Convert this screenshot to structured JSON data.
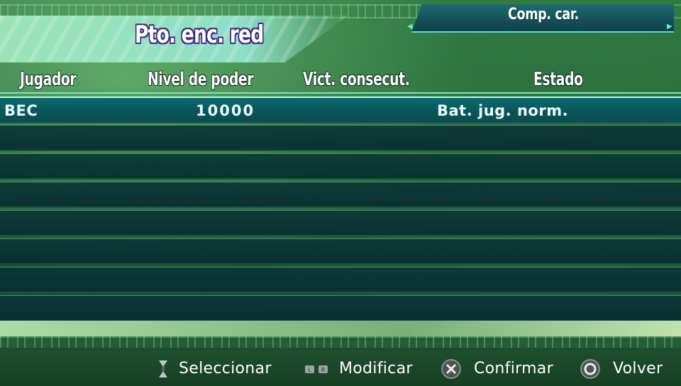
{
  "header": {
    "title": "Pto. enc. red",
    "mode_tab": "Comp. car."
  },
  "table": {
    "columns": [
      "Jugador",
      "Nivel de poder",
      "Vict. consecut.",
      "Estado"
    ],
    "rows": [
      {
        "player": "BEC",
        "power": "10000",
        "wins": "",
        "status": "Bat. jug. norm."
      },
      {
        "player": "",
        "power": "",
        "wins": "",
        "status": ""
      },
      {
        "player": "",
        "power": "",
        "wins": "",
        "status": ""
      },
      {
        "player": "",
        "power": "",
        "wins": "",
        "status": ""
      },
      {
        "player": "",
        "power": "",
        "wins": "",
        "status": ""
      },
      {
        "player": "",
        "power": "",
        "wins": "",
        "status": ""
      },
      {
        "player": "",
        "power": "",
        "wins": "",
        "status": ""
      },
      {
        "player": "",
        "power": "",
        "wins": "",
        "status": ""
      }
    ],
    "selected_row": 0
  },
  "footer": {
    "hints": [
      {
        "icon": "dpad-updown-icon",
        "label": "Seleccionar"
      },
      {
        "icon": "shoulder-buttons-icon",
        "label": "Modificar"
      },
      {
        "icon": "cross-button-icon",
        "label": "Confirmar"
      },
      {
        "icon": "circle-button-icon",
        "label": "Volver"
      }
    ]
  },
  "colors": {
    "accent": "#5fe0c8",
    "title_outline": "#3b2a8c",
    "row_bg": "#0a3a3c",
    "selected_row_bg": "#0a6a6e"
  }
}
